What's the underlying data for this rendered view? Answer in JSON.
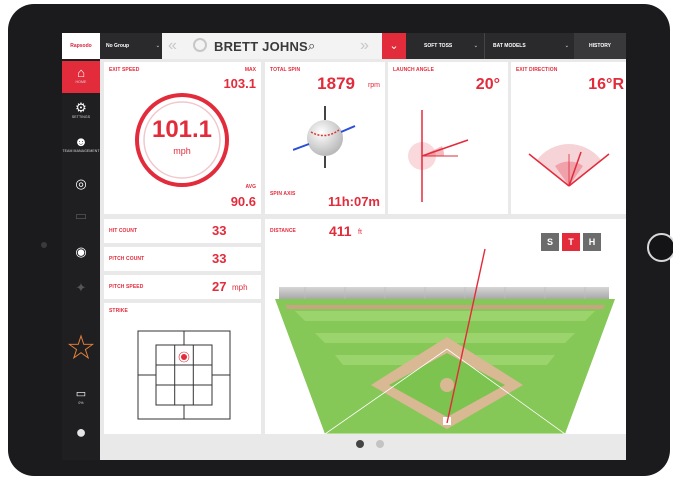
{
  "sidebar": {
    "logo": "Rapsodo",
    "items": [
      {
        "label": "HOME",
        "icon": "home-icon",
        "glyph": "⌂"
      },
      {
        "label": "SETTINGS",
        "icon": "gear-icon",
        "glyph": "⚙"
      },
      {
        "label": "TEAM MANAGEMENT",
        "icon": "team-icon",
        "glyph": "☻"
      },
      {
        "label": "",
        "icon": "camera-icon",
        "glyph": "◎"
      },
      {
        "label": "",
        "icon": "video-icon",
        "glyph": "▭"
      },
      {
        "label": "",
        "icon": "record-icon",
        "glyph": "◉"
      },
      {
        "label": "",
        "icon": "target-icon",
        "glyph": "✦"
      },
      {
        "label": "",
        "icon": "star-icon",
        "glyph": "☆"
      },
      {
        "label": "0%",
        "icon": "battery-icon",
        "glyph": "▭"
      },
      {
        "label": "",
        "icon": "device-icon",
        "glyph": "●"
      }
    ]
  },
  "topbar": {
    "group": "No Group",
    "player_name": "BRETT JOHNS",
    "mode": "SOFT TOSS",
    "bat": "BAT MODELS",
    "history": "HISTORY"
  },
  "exit_speed": {
    "title": "EXIT SPEED",
    "max_label": "MAX",
    "max_value": "103.1",
    "value": "101.1",
    "unit": "mph",
    "avg_label": "AVG",
    "avg_value": "90.6"
  },
  "total_spin": {
    "title": "TOTAL SPIN",
    "value": "1879",
    "unit": "rpm",
    "axis_label": "SPIN AXIS",
    "axis_value": "11h:07m"
  },
  "launch_angle": {
    "title": "LAUNCH ANGLE",
    "value": "20°"
  },
  "exit_direction": {
    "title": "EXIT DIRECTION",
    "value": "16°R"
  },
  "stats": [
    {
      "label": "HIT COUNT",
      "value": "33",
      "unit": ""
    },
    {
      "label": "PITCH COUNT",
      "value": "33",
      "unit": ""
    },
    {
      "label": "PITCH SPEED",
      "value": "27",
      "unit": "mph"
    }
  ],
  "strike": {
    "title": "STRIKE"
  },
  "distance": {
    "title": "DISTANCE",
    "value": "411",
    "unit": "ft"
  },
  "view_buttons": [
    "S",
    "T",
    "H"
  ],
  "colors": {
    "accent": "#e22b3b",
    "sidebar": "#1f1f22",
    "topbar": "#2a2a2d",
    "grass": "#7cc34f"
  }
}
